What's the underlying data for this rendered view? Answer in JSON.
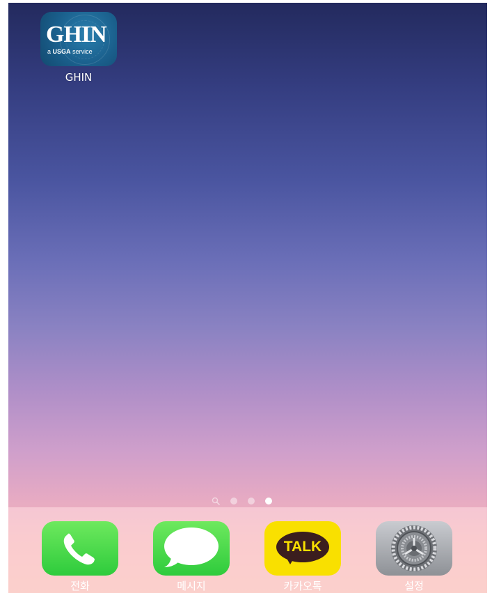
{
  "home": {
    "apps": [
      {
        "label": "GHIN",
        "icon": "ghin-app-icon",
        "logo_text": "GHIN",
        "logo_sub_prefix": "a",
        "logo_sub_brand": "USGA",
        "logo_sub_suffix": "service"
      }
    ]
  },
  "page_indicator": {
    "pages": 4,
    "current_page": 4,
    "first_is_search": true
  },
  "dock": {
    "apps": [
      {
        "label": "전화",
        "icon": "phone-icon"
      },
      {
        "label": "메시지",
        "icon": "messages-icon"
      },
      {
        "label": "카카오톡",
        "icon": "kakaotalk-icon",
        "logo_text": "TALK"
      },
      {
        "label": "설정",
        "icon": "settings-gear-icon"
      }
    ]
  },
  "colors": {
    "ghin_blue": "#1a5f8c",
    "ios_green": "#2ecb3c",
    "kakao_yellow": "#f9e000",
    "kakao_brown": "#3b1e1e"
  }
}
